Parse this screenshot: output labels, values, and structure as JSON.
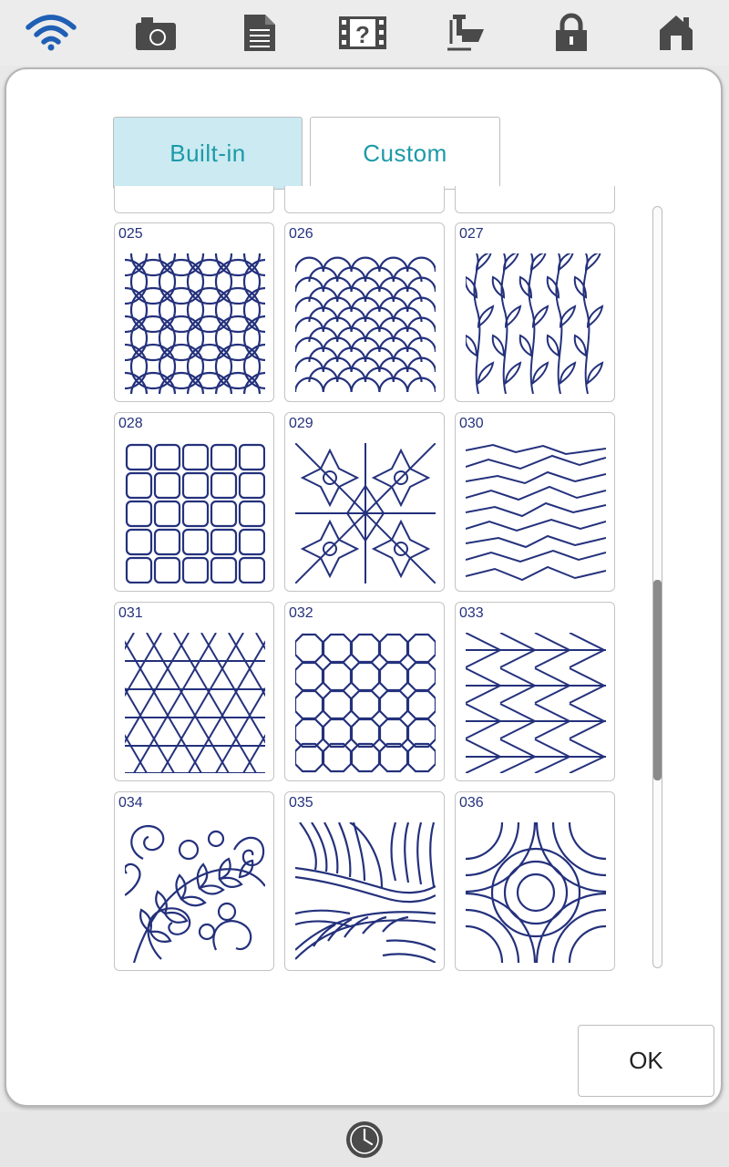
{
  "toolbar": {
    "icons": [
      "wifi-icon",
      "camera-icon",
      "document-icon",
      "help-icon",
      "sewing-foot-icon",
      "lock-icon",
      "home-icon"
    ]
  },
  "tabs": {
    "builtin_label": "Built-in",
    "custom_label": "Custom",
    "selected": "Built-in"
  },
  "patterns": [
    {
      "number": "025",
      "name": "interlocking-circles"
    },
    {
      "number": "026",
      "name": "clamshell"
    },
    {
      "number": "027",
      "name": "vines"
    },
    {
      "number": "028",
      "name": "rounded-grid"
    },
    {
      "number": "029",
      "name": "geometric-stars"
    },
    {
      "number": "030",
      "name": "wavy-lines"
    },
    {
      "number": "031",
      "name": "triangles"
    },
    {
      "number": "032",
      "name": "octagons"
    },
    {
      "number": "033",
      "name": "arrows"
    },
    {
      "number": "034",
      "name": "feathers-swirls"
    },
    {
      "number": "035",
      "name": "leaves"
    },
    {
      "number": "036",
      "name": "circles-arcs"
    }
  ],
  "ok_label": "OK",
  "colors": {
    "stitch": "#24317c",
    "accent": "#1b9aa8",
    "tab_selected_bg": "#cbeaf1",
    "toolbar_icon": "#4a4a4a",
    "wifi": "#1f5fb4"
  }
}
